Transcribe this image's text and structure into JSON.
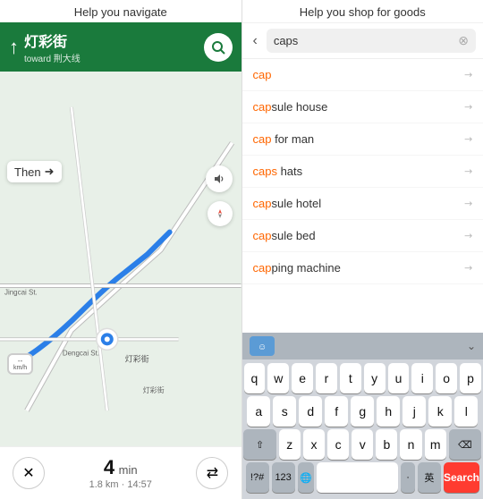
{
  "left": {
    "header": "Help you navigate",
    "street_name": "灯彩街",
    "toward_label": "toward",
    "toward_street": "荆大线",
    "then_label": "Then",
    "time_value": "4",
    "time_unit": "min",
    "dist_time": "1.8 km · 14:57",
    "speed_label": "km/h",
    "cancel_icon": "✕",
    "route_icon": "⇄"
  },
  "right": {
    "header": "Help you shop for goods",
    "search_value": "caps",
    "suggestions": [
      {
        "text": "cap",
        "bold_part": ""
      },
      {
        "text": "capsule house",
        "bold_part": "cap"
      },
      {
        "text": "cap for man",
        "bold_part": "cap"
      },
      {
        "text": "caps hats",
        "bold_part": "caps"
      },
      {
        "text": "capsule hotel",
        "bold_part": "cap"
      },
      {
        "text": "capsule bed",
        "bold_part": "cap"
      },
      {
        "text": "capping machine",
        "bold_part": "cap"
      }
    ]
  },
  "keyboard": {
    "rows": [
      [
        "q",
        "w",
        "e",
        "r",
        "t",
        "y",
        "u",
        "i",
        "o",
        "p"
      ],
      [
        "a",
        "s",
        "d",
        "f",
        "g",
        "h",
        "j",
        "k",
        "l"
      ],
      [
        "⇧",
        "z",
        "x",
        "c",
        "v",
        "b",
        "n",
        "m",
        "⌫"
      ],
      [
        "!?#",
        "123",
        "🌐",
        "",
        "·",
        "英",
        "Search"
      ]
    ]
  }
}
